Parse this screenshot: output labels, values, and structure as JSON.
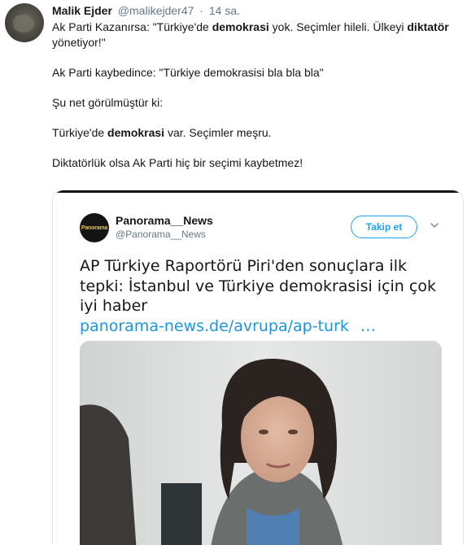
{
  "tweet": {
    "author_name": "Malik Ejder",
    "author_handle": "@malikejder47",
    "separator": "·",
    "time": "14 sa.",
    "p1_a": "Ak Parti Kazanırsa: \"Türkiye'de ",
    "p1_b": "demokrasi",
    "p1_c": " yok. Seçimler hileli. Ülkeyi ",
    "p1_d": "diktatör",
    "p1_e": " yönetiyor!\"",
    "p2": "Ak Parti kaybedince: \"Türkiye demokrasisi bla bla bla\"",
    "p3": "Şu net görülmüştür ki:",
    "p4_a": "Türkiye'de ",
    "p4_b": "demokrasi",
    "p4_c": " var. Seçimler meşru.",
    "p5": "Diktatörlük olsa Ak Parti hiç bir seçimi kaybetmez!"
  },
  "quoted": {
    "avatar_text": "Panorama",
    "name": "Panorama__News",
    "handle": "@Panorama__News",
    "follow_label": "Takip et",
    "title": "AP Türkiye Raportörü Piri'den sonuçlara ilk tepki: İstanbul ve Türkiye demokrasisi için çok iyi haber",
    "link": "panorama-news.de/avrupa/ap-turk",
    "link_ellipsis": "…"
  },
  "icons": {
    "chevron": "chevron-down-icon"
  }
}
